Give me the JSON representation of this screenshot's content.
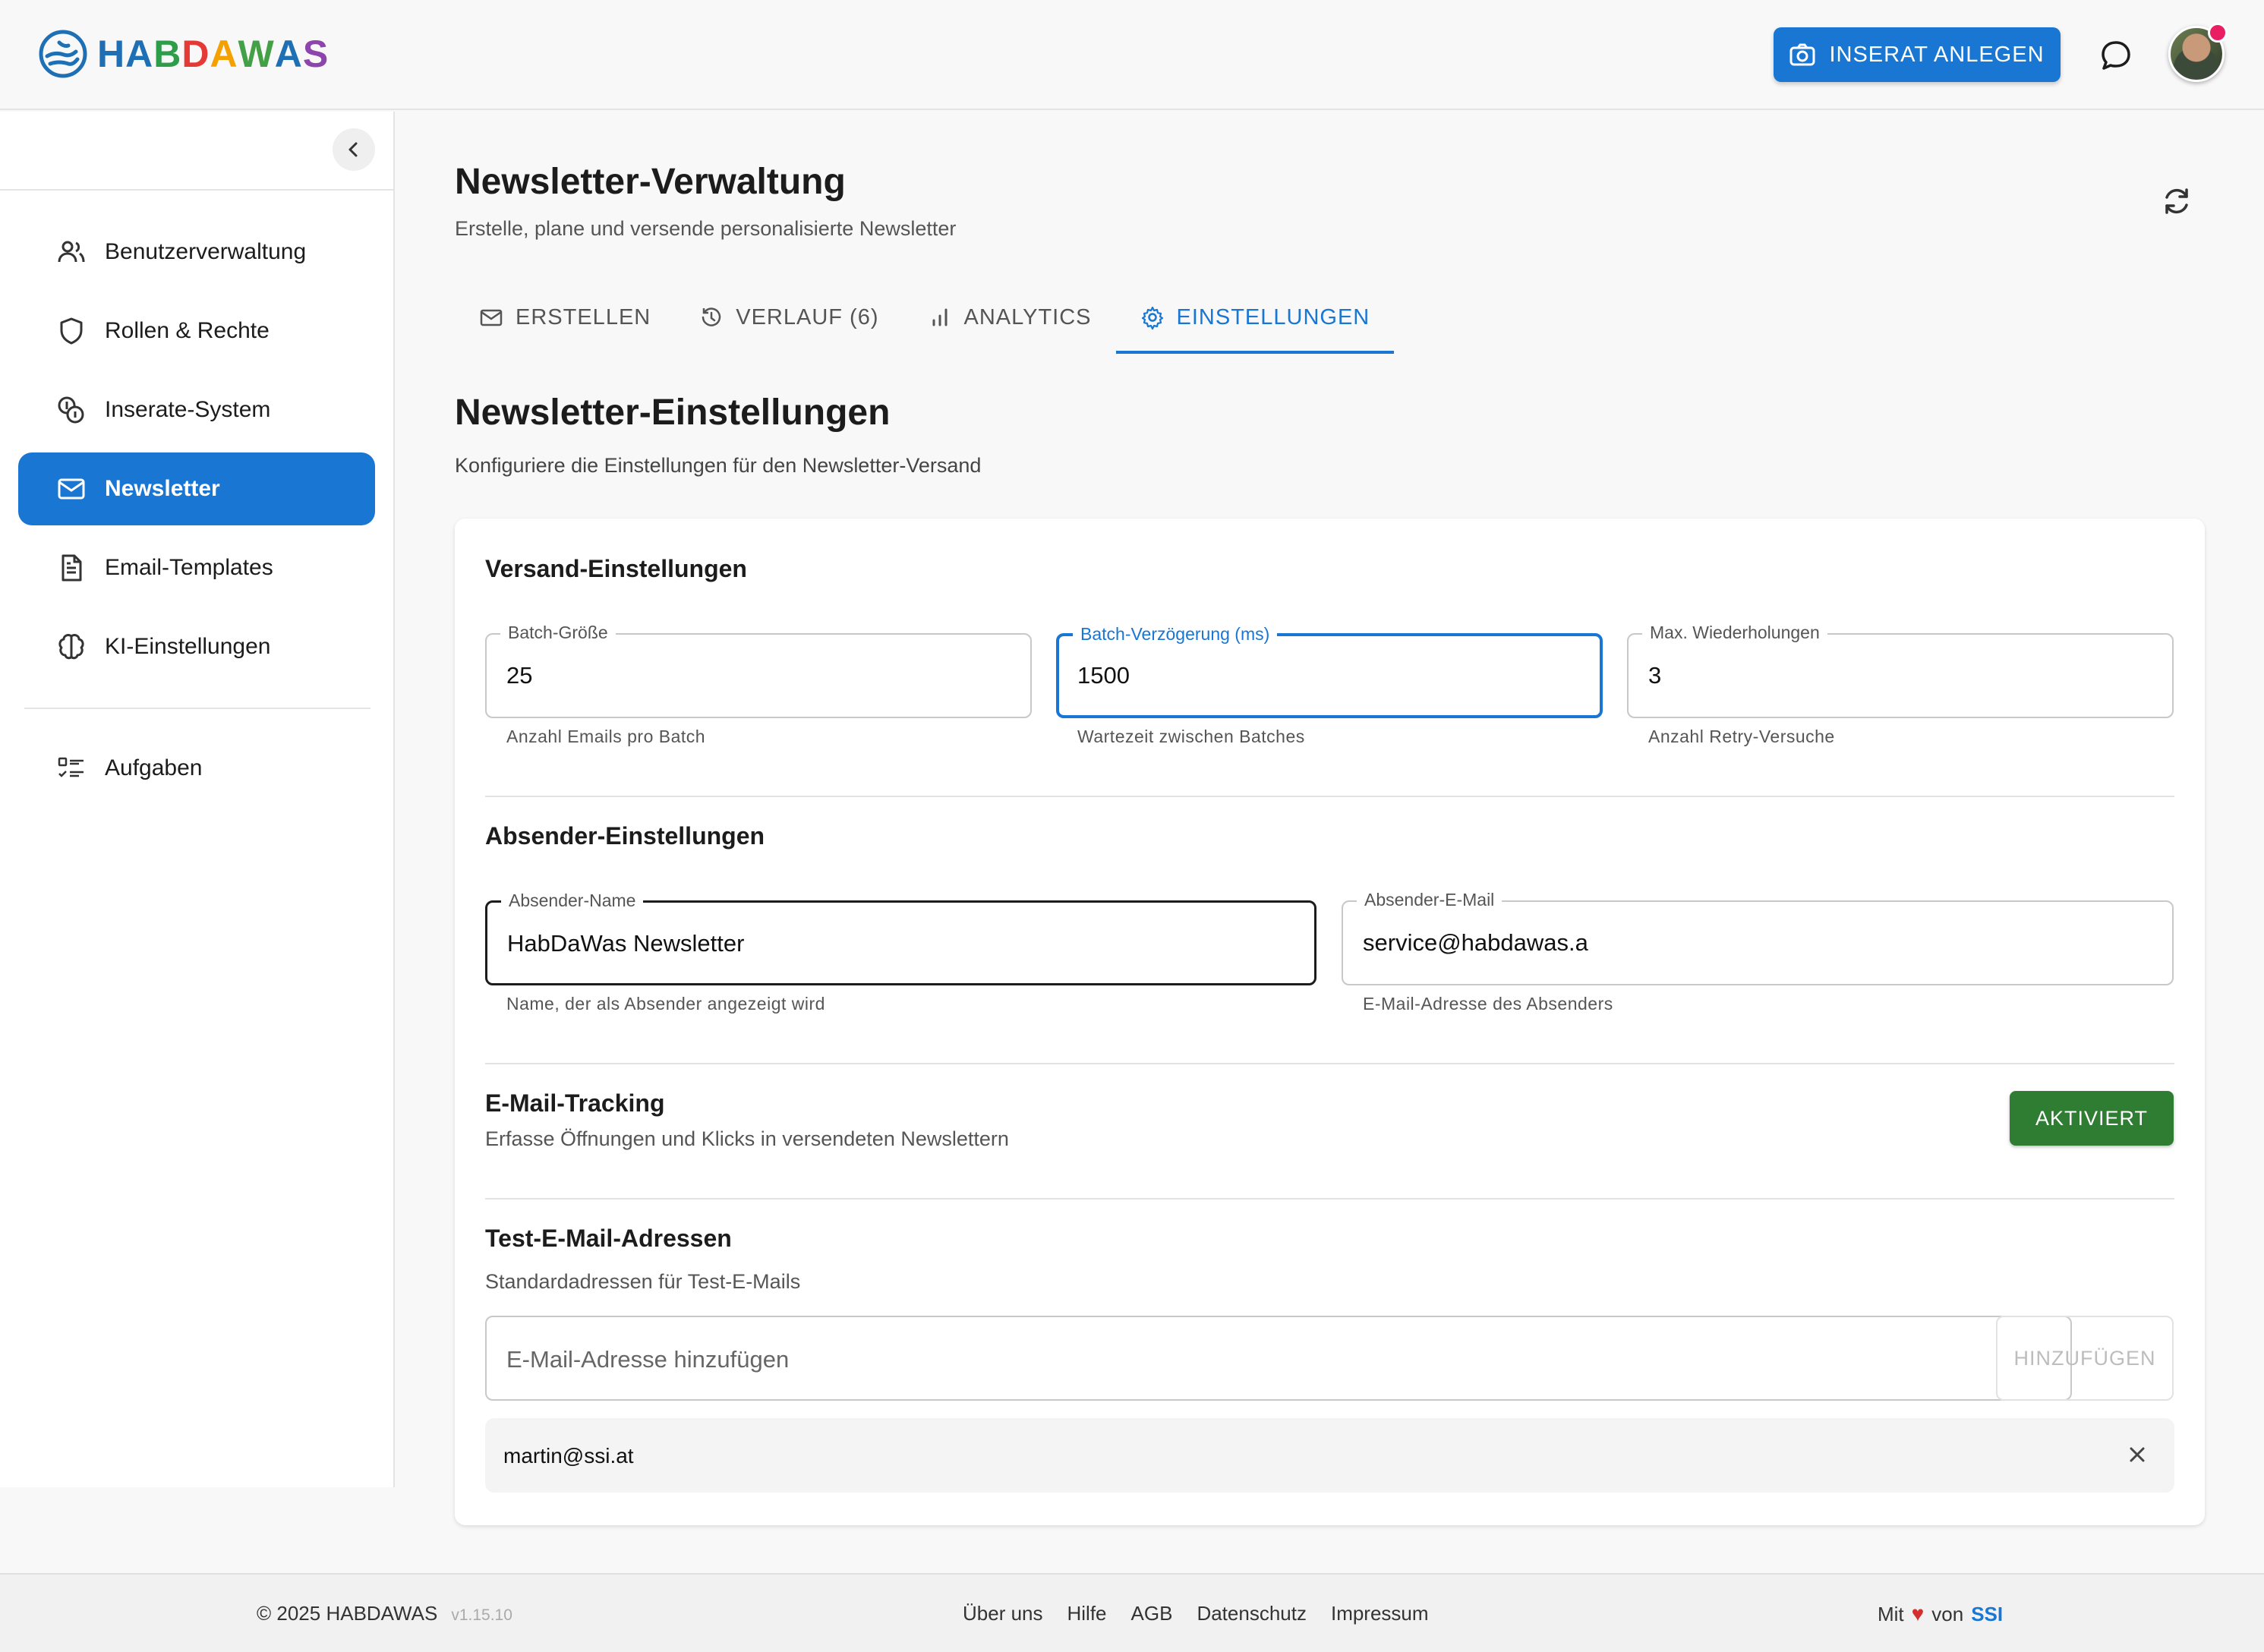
{
  "brand": {
    "letters": [
      "H",
      "A",
      "B",
      "D",
      "A",
      "W",
      "A",
      "S"
    ],
    "letter_colors": [
      "#1f6fb5",
      "#1f6fb5",
      "#2e9d4a",
      "#e53935",
      "#f4a000",
      "#43a047",
      "#1f6fb5",
      "#8e44ad"
    ]
  },
  "header": {
    "create_button": "INSERAT ANLEGEN"
  },
  "sidebar": {
    "items": [
      {
        "label": "Benutzerverwaltung",
        "icon": "users-icon"
      },
      {
        "label": "Rollen & Rechte",
        "icon": "shield-icon"
      },
      {
        "label": "Inserate-System",
        "icon": "coins-icon"
      },
      {
        "label": "Newsletter",
        "icon": "mail-icon",
        "active": true
      },
      {
        "label": "Email-Templates",
        "icon": "document-icon"
      },
      {
        "label": "KI-Einstellungen",
        "icon": "brain-icon"
      },
      {
        "label": "Aufgaben",
        "icon": "task-list-icon"
      }
    ]
  },
  "page": {
    "title": "Newsletter-Verwaltung",
    "subtitle": "Erstelle, plane und versende personalisierte Newsletter"
  },
  "tabs": [
    {
      "label": "ERSTELLEN",
      "icon": "mail-icon"
    },
    {
      "label": "VERLAUF (6)",
      "icon": "history-icon"
    },
    {
      "label": "ANALYTICS",
      "icon": "bar-chart-icon"
    },
    {
      "label": "EINSTELLUNGEN",
      "icon": "gear-icon",
      "active": true
    }
  ],
  "settings": {
    "title": "Newsletter-Einstellungen",
    "subtitle": "Konfiguriere die Einstellungen für den Newsletter-Versand",
    "versand": {
      "title": "Versand-Einstellungen",
      "batch_size": {
        "label": "Batch-Größe",
        "value": "25",
        "helper": "Anzahl Emails pro Batch"
      },
      "batch_delay": {
        "label": "Batch-Verzögerung (ms)",
        "value": "1500",
        "helper": "Wartezeit zwischen Batches"
      },
      "max_retries": {
        "label": "Max. Wiederholungen",
        "value": "3",
        "helper": "Anzahl Retry-Versuche"
      }
    },
    "absender": {
      "title": "Absender-Einstellungen",
      "name": {
        "label": "Absender-Name",
        "value": "HabDaWas Newsletter",
        "helper": "Name, der als Absender angezeigt wird"
      },
      "email": {
        "label": "Absender-E-Mail",
        "value": "service@habdawas.a",
        "helper": "E-Mail-Adresse des Absenders"
      }
    },
    "tracking": {
      "title": "E-Mail-Tracking",
      "description": "Erfasse Öffnungen und Klicks in versendeten Newslettern",
      "button": "AKTIVIERT"
    },
    "test": {
      "title": "Test-E-Mail-Adressen",
      "description": "Standardadressen für Test-E-Mails",
      "placeholder": "E-Mail-Adresse hinzufügen",
      "add_button": "HINZUFÜGEN",
      "addresses": [
        "martin@ssi.at"
      ]
    }
  },
  "footer": {
    "copyright": "© 2025 HABDAWAS",
    "version": "v1.15.10",
    "links": [
      "Über uns",
      "Hilfe",
      "AGB",
      "Datenschutz",
      "Impressum"
    ],
    "made_prefix": "Mit",
    "made_mid": "von",
    "made_by": "SSI"
  },
  "colors": {
    "primary": "#1976d2",
    "success": "#2e7d32",
    "heart": "#d32f2f"
  }
}
